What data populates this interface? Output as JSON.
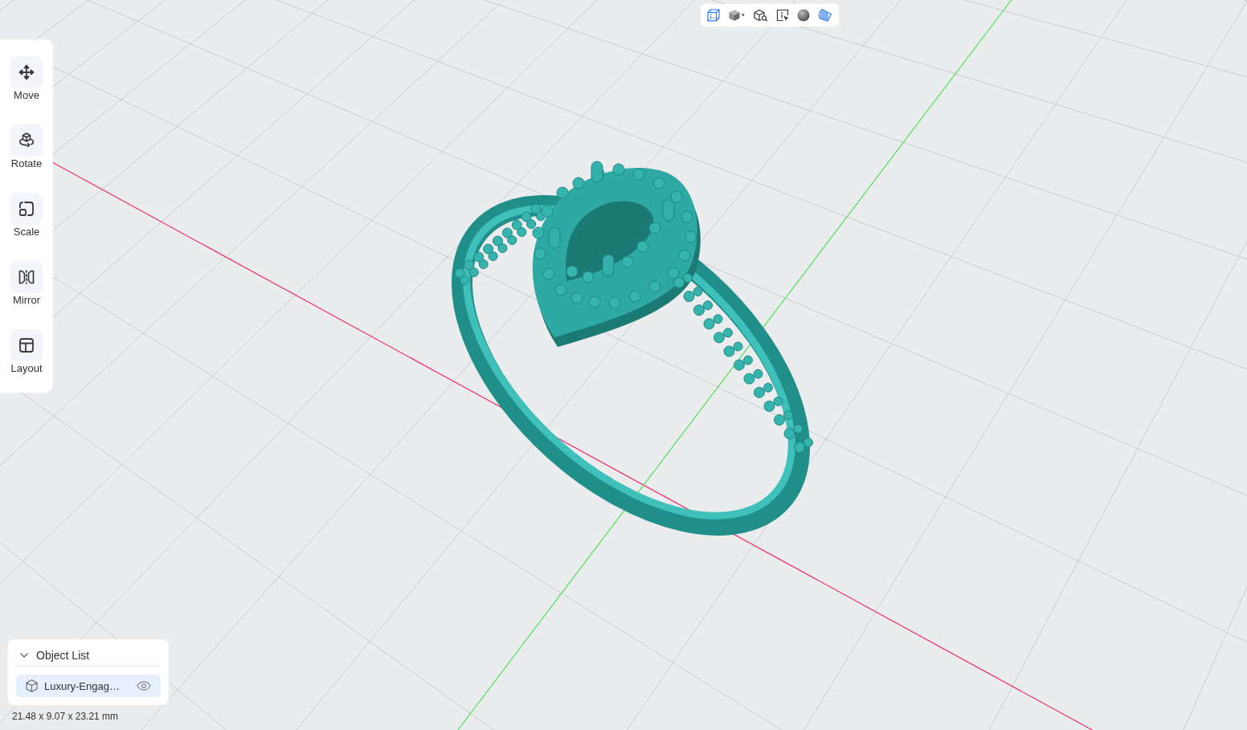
{
  "tools": [
    {
      "kind": "move",
      "label": "Move"
    },
    {
      "kind": "rotate",
      "label": "Rotate"
    },
    {
      "kind": "scale",
      "label": "Scale"
    },
    {
      "kind": "mirror",
      "label": "Mirror"
    },
    {
      "kind": "layout",
      "label": "Layout"
    }
  ],
  "object_list": {
    "title": "Object List",
    "expanded": true,
    "items": [
      {
        "name": "Luxury-Engag…",
        "selected": true,
        "visible": true
      }
    ]
  },
  "dimensions": "21.48 x 9.07 x 23.21 mm"
}
